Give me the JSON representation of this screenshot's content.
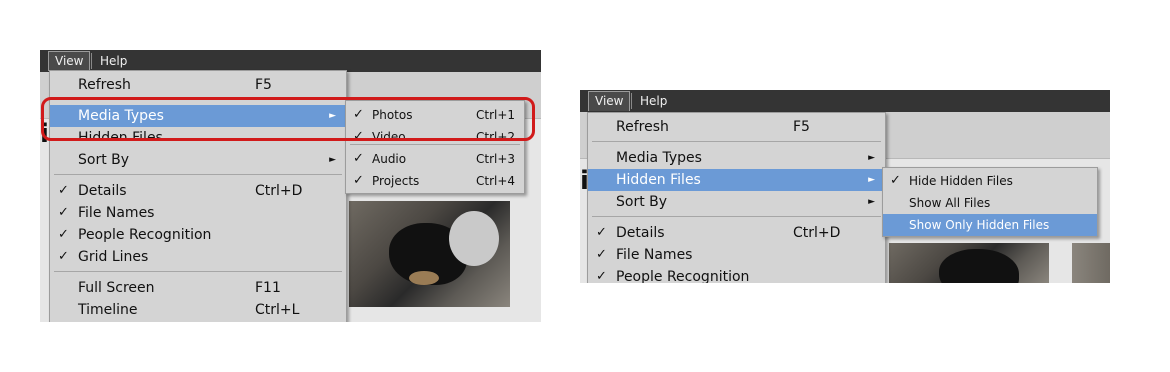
{
  "menubar": {
    "view": "View",
    "help": "Help"
  },
  "left": {
    "main_menu": [
      {
        "label": "Refresh",
        "shortcut": "F5"
      },
      {
        "label": "Media Types",
        "arrow": true,
        "highlighted": true
      },
      {
        "label": "Hidden Files",
        "arrow": true
      },
      {
        "label": "Sort By",
        "arrow": true
      },
      {
        "label": "Details",
        "shortcut": "Ctrl+D",
        "checked": true
      },
      {
        "label": "File Names",
        "checked": true
      },
      {
        "label": "People Recognition",
        "checked": true
      },
      {
        "label": "Grid Lines",
        "checked": true
      },
      {
        "label": "Full Screen",
        "shortcut": "F11"
      },
      {
        "label": "Timeline",
        "shortcut": "Ctrl+L"
      }
    ],
    "submenu": [
      {
        "label": "Photos",
        "shortcut": "Ctrl+1",
        "checked": true
      },
      {
        "label": "Video",
        "shortcut": "Ctrl+2",
        "checked": true
      },
      {
        "label": "Audio",
        "shortcut": "Ctrl+3",
        "checked": true
      },
      {
        "label": "Projects",
        "shortcut": "Ctrl+4",
        "checked": true
      }
    ]
  },
  "right": {
    "main_menu": [
      {
        "label": "Refresh",
        "shortcut": "F5"
      },
      {
        "label": "Media Types",
        "arrow": true
      },
      {
        "label": "Hidden Files",
        "arrow": true,
        "highlighted": true
      },
      {
        "label": "Sort By",
        "arrow": true
      },
      {
        "label": "Details",
        "shortcut": "Ctrl+D",
        "checked": true
      },
      {
        "label": "File Names",
        "checked": true
      },
      {
        "label": "People Recognition",
        "checked": true
      }
    ],
    "submenu": [
      {
        "label": "Hide Hidden Files",
        "checked": true
      },
      {
        "label": "Show All Files"
      },
      {
        "label": "Show Only Hidden Files",
        "highlighted": true
      }
    ]
  },
  "glyphs": {
    "check": "✓",
    "arrow": "►"
  },
  "colors": {
    "highlight": "#6b9ad6",
    "callout": "#d11a1a",
    "menubar": "#343434",
    "menu_bg": "#d4d4d4"
  }
}
